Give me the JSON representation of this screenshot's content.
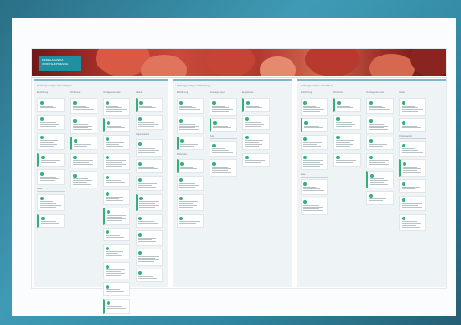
{
  "banner": {
    "logo_line1": "MODELAGENDA",
    "logo_line2": "WORKSHOPDESIGN"
  },
  "sections": [
    {
      "title": "Vertragsanalyse Grundlagen",
      "columns": [
        {
          "header": "Einführung",
          "cards": 5,
          "sub": "Ziele",
          "subcards": 2
        },
        {
          "header": "Workshop",
          "cards": 5
        },
        {
          "header": "Vertragselemente",
          "cards": 12
        },
        {
          "header": "Ablauf",
          "cards": 2,
          "sub": "Organisation",
          "subcards": 8
        }
      ]
    },
    {
      "title": "Vertragsanalyse Vertiefung",
      "columns": [
        {
          "header": "Einführung",
          "cards": 3,
          "sub": "Methoden",
          "subcards": 4
        },
        {
          "header": "Arbeitsgruppen",
          "cards": 2,
          "sub": "Ziele",
          "subcards": 2
        },
        {
          "header": "Ergebnisse",
          "cards": 4
        }
      ]
    },
    {
      "title": "Vertragsanalyse Abschluss",
      "columns": [
        {
          "header": "Einführung",
          "cards": 4,
          "sub": "Ziele",
          "subcards": 2
        },
        {
          "header": "Workshop",
          "cards": 4
        },
        {
          "header": "Vertragselemente",
          "cards": 6
        },
        {
          "header": "Ablauf",
          "cards": 2,
          "sub": "Organisation",
          "subcards": 5
        }
      ]
    }
  ]
}
